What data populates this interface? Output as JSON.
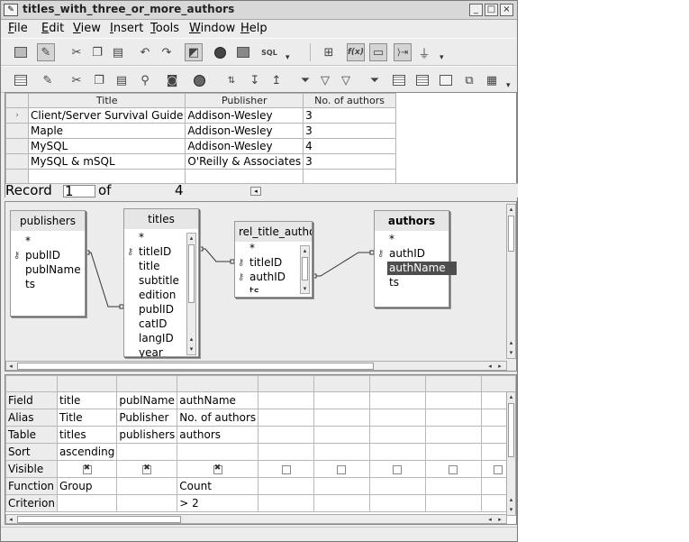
{
  "window": {
    "title": "titles_with_three_or_more_authors",
    "controls": [
      "_",
      "□",
      "×"
    ]
  },
  "menubar": {
    "items": [
      {
        "label": "File",
        "u": "F",
        "rest": "ile"
      },
      {
        "label": "Edit",
        "u": "E",
        "rest": "dit"
      },
      {
        "label": "View",
        "u": "V",
        "rest": "iew"
      },
      {
        "label": "Insert",
        "u": "I",
        "rest": "nsert"
      },
      {
        "label": "Tools",
        "u": "T",
        "rest": "ools"
      },
      {
        "label": "Window",
        "u": "W",
        "rest": "indow"
      },
      {
        "label": "Help",
        "u": "H",
        "rest": "elp"
      }
    ]
  },
  "toolbar1": {
    "icons": [
      "save-icon",
      "edit-mode-icon",
      "cut-icon",
      "copy-icon",
      "paste-icon",
      "undo-icon",
      "redo-icon",
      "design-view-icon",
      "run-query-icon",
      "clear-query-icon",
      "sql-mode-icon",
      "add-tables-icon",
      "functions-icon",
      "table-name-icon",
      "alias-icon",
      "distinct-values-icon"
    ],
    "labels": {
      "sql": "SQL",
      "functions": "f(x)",
      "distinct": "1231"
    }
  },
  "toolbar2": {
    "icons": [
      "form-view-icon",
      "edit-data-icon",
      "cut-icon",
      "copy-icon",
      "paste-icon",
      "find-icon",
      "sort-asc-icon",
      "sort-desc-icon",
      "autofilter-icon",
      "standard-filter-icon",
      "remove-filter-icon",
      "data-to-text-icon",
      "data-to-fields-icon",
      "mail-merge-icon",
      "explorer-icon"
    ]
  },
  "results": {
    "columns": [
      "Title",
      "Publisher",
      "No. of authors"
    ],
    "rows": [
      [
        "Client/Server Survival Guide",
        "Addison-Wesley",
        "3"
      ],
      [
        "Maple",
        "Addison-Wesley",
        "3"
      ],
      [
        "MySQL",
        "Addison-Wesley",
        "4"
      ],
      [
        "MySQL & mSQL",
        "O'Reilly & Associates",
        "3"
      ]
    ],
    "current_row_marker": "›",
    "record_label": "Record",
    "record_value": "1",
    "of_label": "of",
    "total": "4"
  },
  "design": {
    "tables": {
      "publishers": {
        "name": "publishers",
        "fields": [
          "*",
          "publID",
          "publName",
          "ts"
        ],
        "keys": [
          "publID"
        ]
      },
      "titles": {
        "name": "titles",
        "fields": [
          "*",
          "titleID",
          "title",
          "subtitle",
          "edition",
          "publID",
          "catID",
          "langID",
          "year"
        ],
        "keys": [
          "titleID"
        ]
      },
      "rel_title_author": {
        "name": "rel_title_author",
        "fields": [
          "*",
          "titleID",
          "authID",
          "ts"
        ],
        "keys": [
          "titleID",
          "authID"
        ]
      },
      "authors": {
        "name": "authors",
        "fields": [
          "*",
          "authID",
          "authName",
          "ts"
        ],
        "keys": [
          "authID"
        ],
        "selected": "authName"
      }
    }
  },
  "grid": {
    "row_labels": [
      "Field",
      "Alias",
      "Table",
      "Sort",
      "Visible",
      "Function",
      "Criterion"
    ],
    "columns": [
      {
        "field": "title",
        "alias": "Title",
        "table": "titles",
        "sort": "ascending",
        "visible": true,
        "function": "Group",
        "criterion": ""
      },
      {
        "field": "publName",
        "alias": "Publisher",
        "table": "publishers",
        "sort": "",
        "visible": true,
        "function": "",
        "criterion": ""
      },
      {
        "field": "authName",
        "alias": "No. of authors",
        "table": "authors",
        "sort": "",
        "visible": true,
        "function": "Count",
        "criterion": "> 2"
      },
      {
        "field": "",
        "alias": "",
        "table": "",
        "sort": "",
        "visible": false,
        "function": "",
        "criterion": ""
      },
      {
        "field": "",
        "alias": "",
        "table": "",
        "sort": "",
        "visible": false,
        "function": "",
        "criterion": ""
      },
      {
        "field": "",
        "alias": "",
        "table": "",
        "sort": "",
        "visible": false,
        "function": "",
        "criterion": ""
      },
      {
        "field": "",
        "alias": "",
        "table": "",
        "sort": "",
        "visible": false,
        "function": "",
        "criterion": ""
      },
      {
        "field": "",
        "alias": "",
        "table": "",
        "sort": "",
        "visible": false,
        "function": "",
        "criterion": ""
      }
    ]
  },
  "colors": {
    "selection": "#4e4e4e",
    "chrome": "#ececec",
    "grid_line": "#b8b8b8"
  }
}
